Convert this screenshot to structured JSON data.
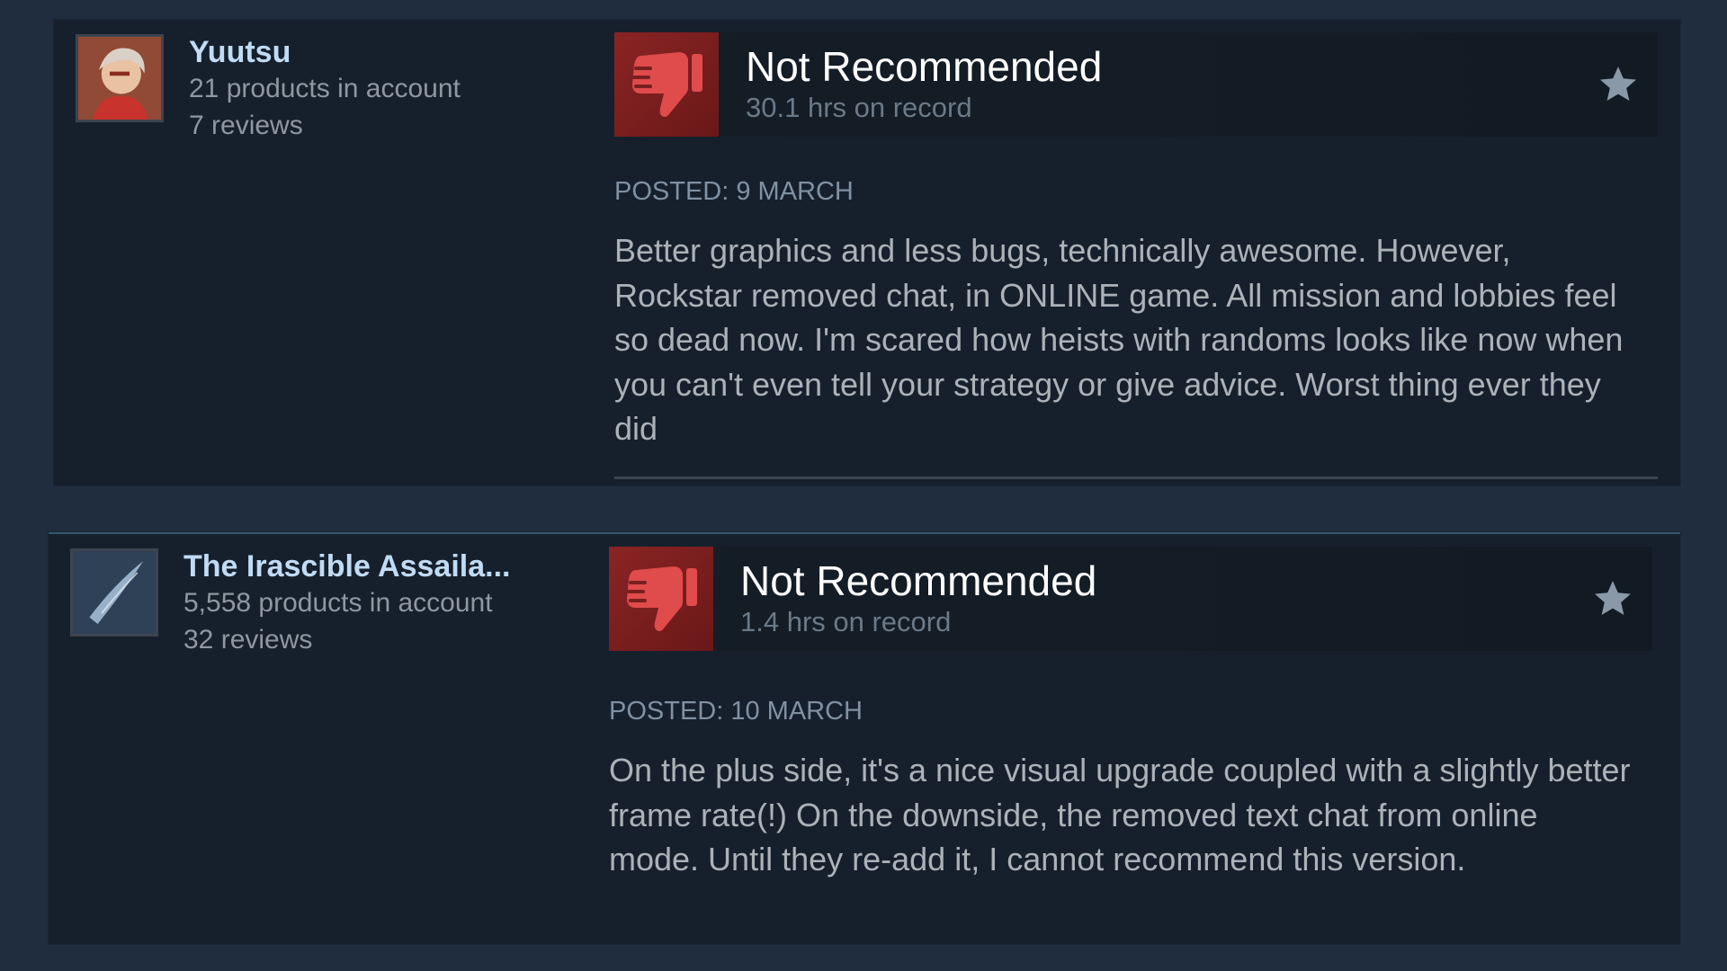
{
  "reviews": [
    {
      "author": {
        "name": "Yuutsu",
        "products": "21 products in account",
        "reviews": "7 reviews"
      },
      "verdict": "Not Recommended",
      "hours": "30.1 hrs on record",
      "posted": "POSTED: 9 MARCH",
      "content": "Better graphics and less bugs, technically awesome. However, Rockstar removed chat, in ONLINE game. All mission and lobbies feel so dead now. I'm scared how heists with randoms looks like now when you can't even tell your strategy or give advice. Worst thing ever they did"
    },
    {
      "author": {
        "name": "The Irascible Assaila...",
        "products": "5,558 products in account",
        "reviews": "32 reviews"
      },
      "verdict": "Not Recommended",
      "hours": "1.4 hrs on record",
      "posted": "POSTED: 10 MARCH",
      "content": "On the plus side, it's a nice visual upgrade coupled with a slightly better frame rate(!) On the downside, the removed text chat from online mode. Until they re-add it, I cannot recommend this version."
    }
  ],
  "icons": {
    "thumb": "thumbs-down-icon",
    "award": "star-icon"
  },
  "colors": {
    "background": "#1f2d3e",
    "card": "#16202d",
    "thumb_bg": "#7a1f1f",
    "thumb_fg": "#e04b4b",
    "author_name": "#c1dbf4",
    "muted": "#8f98a0"
  }
}
